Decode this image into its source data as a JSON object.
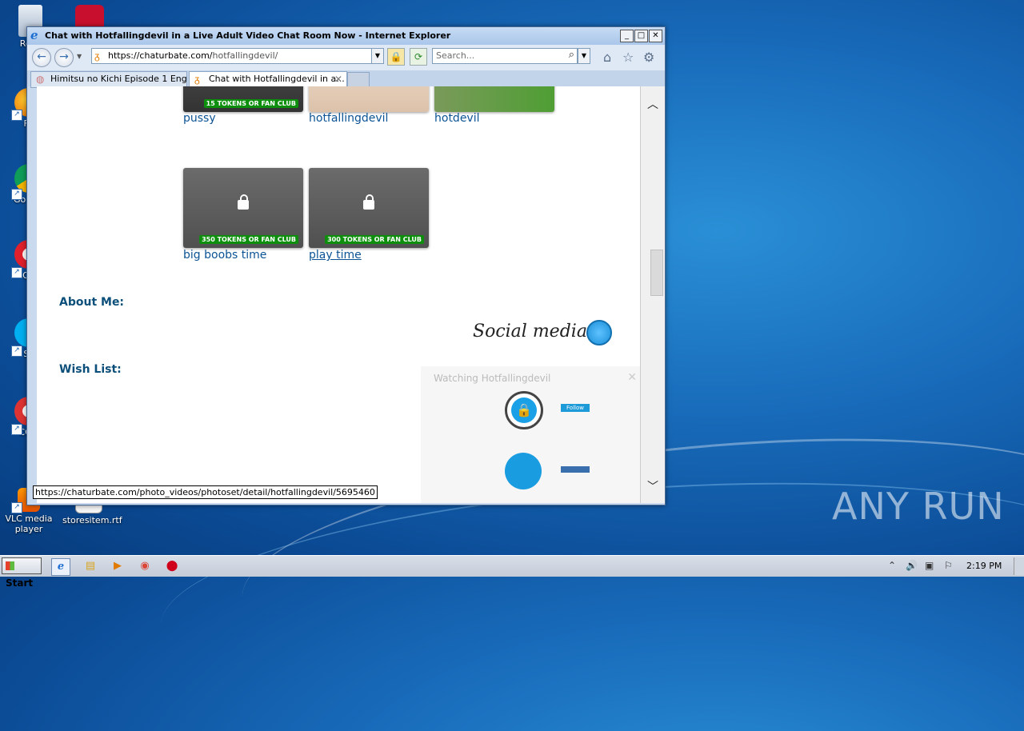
{
  "window": {
    "title": "Chat with Hotfallingdevil in a Live Adult Video Chat Room Now - Internet Explorer",
    "min": "_",
    "max": "□",
    "close": "✕"
  },
  "address": {
    "url_host": "https://chaturbate.com/",
    "url_path": "hotfallingdevil/",
    "search_placeholder": "Search..."
  },
  "tabs": [
    {
      "label": "Himitsu no Kichi Episode 1 Englis..."
    },
    {
      "label": "Chat with Hotfallingdevil in a...",
      "close": "✕"
    }
  ],
  "photo_sets": [
    {
      "title": "pussy",
      "badge": "15 TOKENS OR FAN CLUB"
    },
    {
      "title": "hotfallingdevil"
    },
    {
      "title": "hotdevil"
    },
    {
      "title": "big boobs time",
      "badge": "350 TOKENS OR FAN CLUB"
    },
    {
      "title": "play time",
      "badge": "300 TOKENS OR FAN CLUB"
    }
  ],
  "sections": {
    "about": "About Me:",
    "wishlist": "Wish List:"
  },
  "overlay": {
    "watching": "Watching Hotfallingdevil",
    "social_media": "Social media",
    "follow": "Follow",
    "close": "✕"
  },
  "status_url": "https://chaturbate.com/photo_videos/photoset/detail/hotfallingdevil/5695460",
  "desktop_icons": [
    {
      "label": "Recy"
    },
    {
      "label": "Fir"
    },
    {
      "label": "Go\nChr"
    },
    {
      "label": "Op"
    },
    {
      "label": "Sk"
    },
    {
      "label": "CCle"
    },
    {
      "label": "VLC media player"
    },
    {
      "label": "storesitem.rtf"
    }
  ],
  "taskbar": {
    "start": "Start",
    "clock": "2:19 PM"
  },
  "watermark": "ANY RUN"
}
